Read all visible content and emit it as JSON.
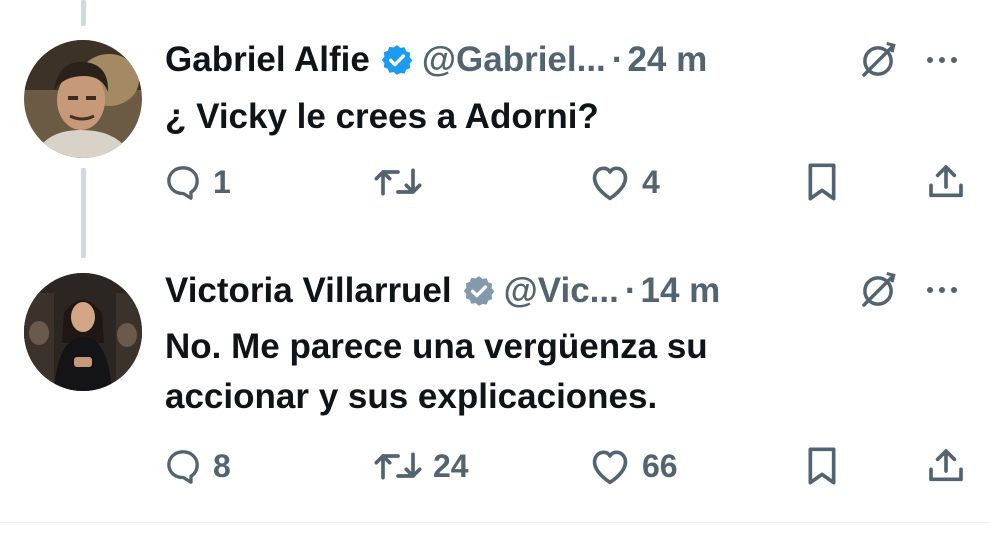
{
  "tweets": [
    {
      "author": "Gabriel Alfie",
      "handle": "@Gabriel...",
      "separator": "·",
      "time": "24 m",
      "text_lines": [
        "¿ Vicky le crees a Adorni?"
      ],
      "verified_color": "#1d9bf0",
      "avatar_icon": "avatar-gabriel",
      "stats": {
        "replies": "1",
        "retweets": "",
        "likes": "4"
      }
    },
    {
      "author": "Victoria Villarruel",
      "handle": "@Vic...",
      "separator": "·",
      "time": "14 m",
      "text_lines": [
        "No. Me parece una vergüenza su",
        "accionar y sus explicaciones."
      ],
      "verified_color": "#829aab",
      "avatar_icon": "avatar-victoria",
      "stats": {
        "replies": "8",
        "retweets": "24",
        "likes": "66"
      }
    }
  ],
  "colors": {
    "text": "#0f1419",
    "secondary": "#536471",
    "thread": "#cfd9de"
  }
}
